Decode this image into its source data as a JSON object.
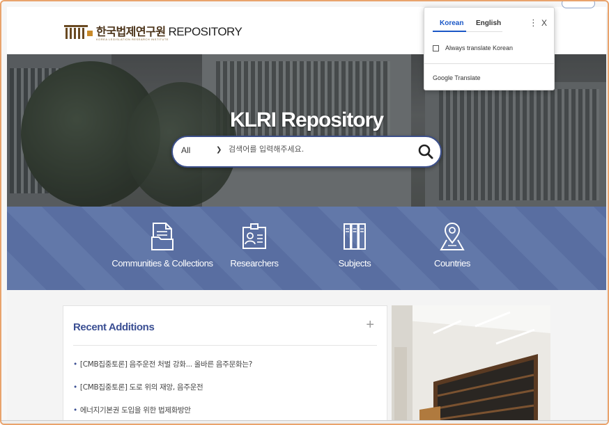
{
  "header": {
    "logo_korean": "한국법제연구원",
    "logo_english": "REPOSITORY",
    "logo_subtext": "KOREA LEGISLATION RESEARCH INSTITUTE"
  },
  "hero": {
    "title": "KLRI Repository"
  },
  "search": {
    "scope_value": "All",
    "placeholder": "검색어를 입력해주세요.",
    "value": ""
  },
  "categories": [
    {
      "label": "Communities & Collections",
      "icon": "document-folder-icon"
    },
    {
      "label": "Researchers",
      "icon": "id-card-icon"
    },
    {
      "label": "Subjects",
      "icon": "bookshelf-icon"
    },
    {
      "label": "Countries",
      "icon": "map-pin-icon"
    }
  ],
  "recent": {
    "title": "Recent Additions",
    "more_label": "+",
    "items": [
      "[CMB집중토론] 음주운전 처벌 강화... 올바른 음주문화는?",
      "[CMB집중토론] 도로 위의 재앙, 음주운전",
      "에너지기본권 도입을 위한 법제화방안"
    ]
  },
  "translate_popup": {
    "tab_source": "Korean",
    "tab_target": "English",
    "menu_icon": "⋮",
    "close_icon": "X",
    "always_translate_label": "Always translate Korean",
    "footer": "Google Translate",
    "active_color": "#1a57c6"
  },
  "colors": {
    "band": "#5c72a6",
    "title_blue": "#3b4f93",
    "frame": "#e9a36c"
  }
}
